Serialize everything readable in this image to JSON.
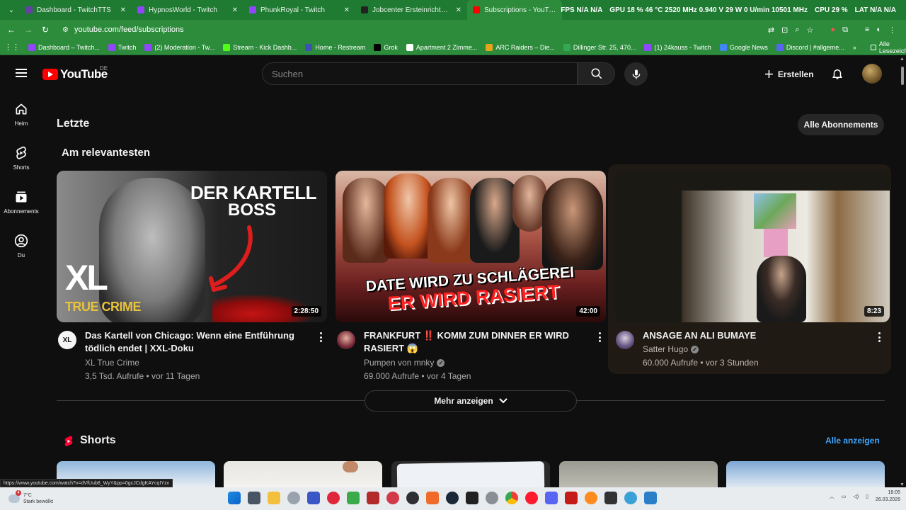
{
  "browser": {
    "tabs": [
      {
        "label": "Dashboard - TwitchTTS",
        "color": "#6441a5"
      },
      {
        "label": "HypnosWorld - Twitch",
        "color": "#9146ff"
      },
      {
        "label": "PhunkRoyal - Twitch",
        "color": "#9146ff"
      },
      {
        "label": "Jobcenter Ersteinrichtung: Betr",
        "color": "#222222"
      },
      {
        "label": "Subscriptions - YouTube",
        "color": "#ff0000"
      }
    ],
    "hud": [
      "FPS N/A N/A",
      "GPU 18 % 46 °C 2520 MHz 0.940 V 29 W 0 U/min 10501 MHz",
      "CPU 29 %",
      "LAT N/A N/A"
    ],
    "url": "youtube.com/feed/subscriptions",
    "bookmarks": [
      {
        "label": "Dashboard – Twitch...",
        "color": "#9146ff"
      },
      {
        "label": "Twitch",
        "color": "#9146ff"
      },
      {
        "label": "(2) Moderation - Tw...",
        "color": "#9146ff"
      },
      {
        "label": "Stream - Kick Dashb...",
        "color": "#53fc18"
      },
      {
        "label": "Home - Restream",
        "color": "#3f51b5"
      },
      {
        "label": "Grok",
        "color": "#000000"
      },
      {
        "label": "Apartment 2 Zimme...",
        "color": "#ffffff"
      },
      {
        "label": "ARC Raiders – Die...",
        "color": "#e8a31b"
      },
      {
        "label": "Dillinger Str. 25, 470...",
        "color": "#34a853"
      },
      {
        "label": "(1) 24kauss - Twitch",
        "color": "#9146ff"
      },
      {
        "label": "Google News",
        "color": "#4285f4"
      },
      {
        "label": "Discord | #allgeme...",
        "color": "#5865f2"
      }
    ],
    "bookmarks_more": "»",
    "bookmarks_all": "Alle Lesezeichen"
  },
  "header": {
    "logo_text": "YouTube",
    "region": "DE",
    "search_placeholder": "Suchen",
    "create_label": "Erstellen"
  },
  "sidebar": [
    {
      "label": "Heim",
      "icon": "home-icon"
    },
    {
      "label": "Shorts",
      "icon": "shorts-icon"
    },
    {
      "label": "Abonnements",
      "icon": "subscriptions-icon"
    },
    {
      "label": "Du",
      "icon": "you-icon"
    }
  ],
  "main": {
    "section_title": "Letzte",
    "all_subscriptions_label": "Alle Abonnements",
    "relevant_title": "Am relevantesten",
    "videos": [
      {
        "thumb_text_top": "DER KARTELL",
        "thumb_text_bottom": "BOSS",
        "thumb_badge_main": "XL",
        "thumb_badge_sub": "TRUE CRIME",
        "duration": "2:28:50",
        "title": "Das Kartell von Chicago: Wenn eine Entführung tödlich endet | XXL-Doku",
        "channel": "XL True Crime",
        "meta": "3,5 Tsd. Aufrufe • vor 11 Tagen"
      },
      {
        "thumb_text_top": "DATE WIRD ZU SCHLÄGEREI",
        "thumb_text_bottom": "ER WIRD RASIERT",
        "duration": "42:00",
        "title": "FRANKFURT ‼️ KOMM ZUM DINNER ER WIRD RASIERT 😱",
        "channel": "Pumpen von mnky",
        "meta": "69.000 Aufrufe • vor 4 Tagen"
      },
      {
        "duration": "8:23",
        "title": "ANSAGE AN ALI BUMAYE",
        "channel": "Satter Hugo",
        "meta": "60.000 Aufrufe • vor 3 Stunden"
      }
    ],
    "more_label": "Mehr anzeigen",
    "shorts_title": "Shorts",
    "shorts_all_label": "Alle anzeigen"
  },
  "status_url": "https://www.youtube.com/watch?v=dVfUub8_WyY&pp=0gcJCdgKAYcqIYzv",
  "taskbar": {
    "weather_temp": "7°C",
    "weather_desc": "Stark bewölkt",
    "weather_badge": "4",
    "time": "18:05",
    "date": "26.03.2026"
  }
}
